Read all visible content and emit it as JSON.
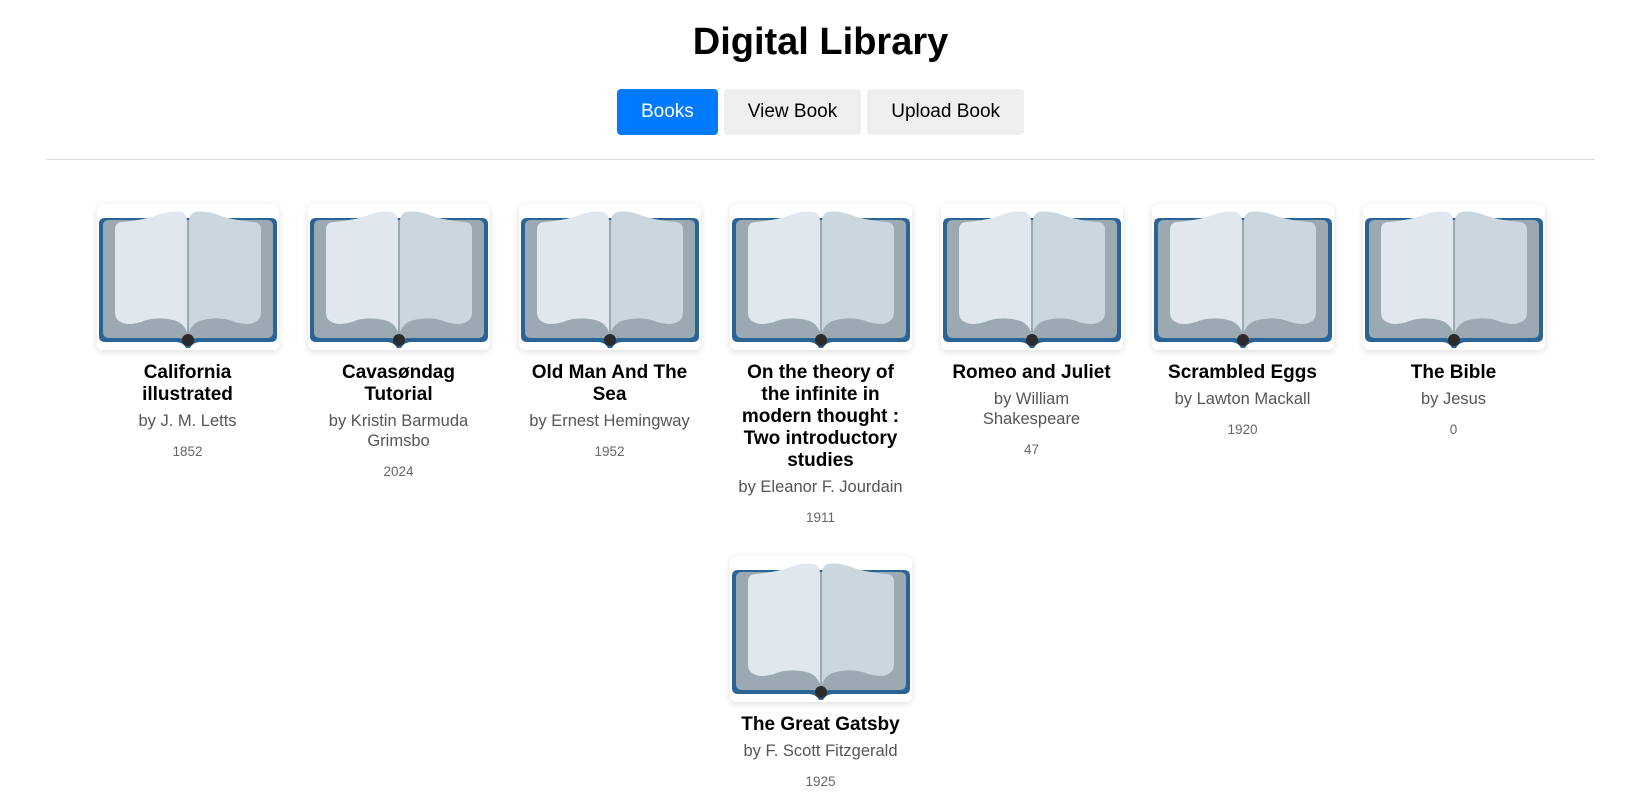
{
  "app": {
    "title": "Digital Library"
  },
  "nav": {
    "items": [
      {
        "label": "Books",
        "active": true
      },
      {
        "label": "View Book",
        "active": false
      },
      {
        "label": "Upload Book",
        "active": false
      }
    ],
    "active_color": "#007bff",
    "inactive_color": "#efefef"
  },
  "books": [
    {
      "title": "California illustrated",
      "author": "by J. M. Letts",
      "year": "1852",
      "cover_icon": "open-book-icon"
    },
    {
      "title": "Cavasøndag Tutorial",
      "author": "by Kristin Barmuda Grimsbo",
      "year": "2024",
      "cover_icon": "open-book-icon"
    },
    {
      "title": "Old Man And The Sea",
      "author": "by Ernest Hemingway",
      "year": "1952",
      "cover_icon": "open-book-icon"
    },
    {
      "title": "On the theory of the infinite in modern thought : Two introductory studies",
      "author": "by Eleanor F. Jourdain",
      "year": "1911",
      "cover_icon": "open-book-icon"
    },
    {
      "title": "Romeo and Juliet",
      "author": "by William Shakespeare",
      "year": "47",
      "cover_icon": "open-book-icon"
    },
    {
      "title": "Scrambled Eggs",
      "author": "by Lawton Mackall",
      "year": "1920",
      "cover_icon": "open-book-icon"
    },
    {
      "title": "The Bible",
      "author": "by Jesus",
      "year": "0",
      "cover_icon": "open-book-icon"
    },
    {
      "title": "The Great Gatsby",
      "author": "by F. Scott Fitzgerald",
      "year": "1925",
      "cover_icon": "open-book-icon"
    }
  ]
}
